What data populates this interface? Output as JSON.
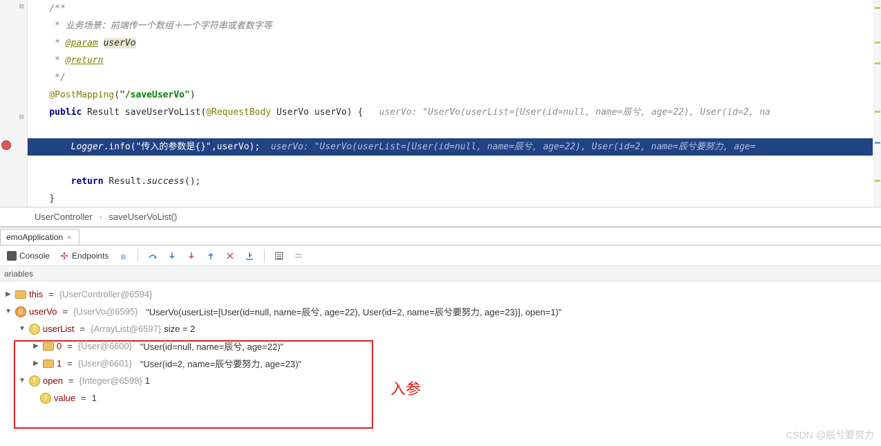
{
  "breadcrumb": {
    "class": "UserController",
    "method": "saveUserVoList()"
  },
  "code": {
    "comment_open": "/**",
    "comment_desc": " * 业务场景：前端传一个数组＋一个字符串或者数字等",
    "comment_param_tag": "@param",
    "comment_param_name": "userVo",
    "comment_return": "@return",
    "comment_close": " */",
    "annotation": "@PostMapping",
    "mapping_path": "\"/saveUserVo\"",
    "kw_public": "public",
    "type_result": "Result",
    "method_name": "saveUserVoList",
    "request_body": "@RequestBody",
    "param_type": "UserVo",
    "param_name": "userVo",
    "inlay_sig": "userVo: \"UserVo(userList=[User(id=null, name=辰兮, age=22), User(id=2, na",
    "logger": "Logger",
    "logger_method": ".info(",
    "logger_msg": "\"传入的参数是{}\"",
    "logger_tail": ",userVo);",
    "inlay_hl": "userVo: \"UserVo(userList=[User(id=null, name=辰兮, age=22), User(id=2, name=辰兮要努力, age=",
    "kw_return": "return",
    "ret_call": " Result.",
    "ret_method": "success",
    "ret_tail": "();",
    "close_brace": "}"
  },
  "debug": {
    "tab": "emoApplication",
    "console": "Console",
    "endpoints": "Endpoints",
    "vars_label": "ariables"
  },
  "vars": {
    "this_name": "this",
    "this_val": "{UserController@6594}",
    "uservo_name": "userVo",
    "uservo_type": "{UserVo@6595}",
    "uservo_str": "\"UserVo(userList=[User(id=null, name=辰兮, age=22), User(id=2, name=辰兮要努力, age=23)], open=1)\"",
    "userlist_name": "userList",
    "userlist_type": "{ArrayList@6597}",
    "userlist_size": " size = 2",
    "item0_idx": "0",
    "item0_type": "{User@6600}",
    "item0_str": "\"User(id=null, name=辰兮, age=22)\"",
    "item1_idx": "1",
    "item1_type": "{User@6601}",
    "item1_str": "\"User(id=2, name=辰兮要努力, age=23)\"",
    "open_name": "open",
    "open_type": "{Integer@6598}",
    "open_val": " 1",
    "value_name": "value",
    "value_val": "1"
  },
  "annotation": {
    "text": "入参"
  },
  "watermark": "CSDN @辰兮要努力"
}
